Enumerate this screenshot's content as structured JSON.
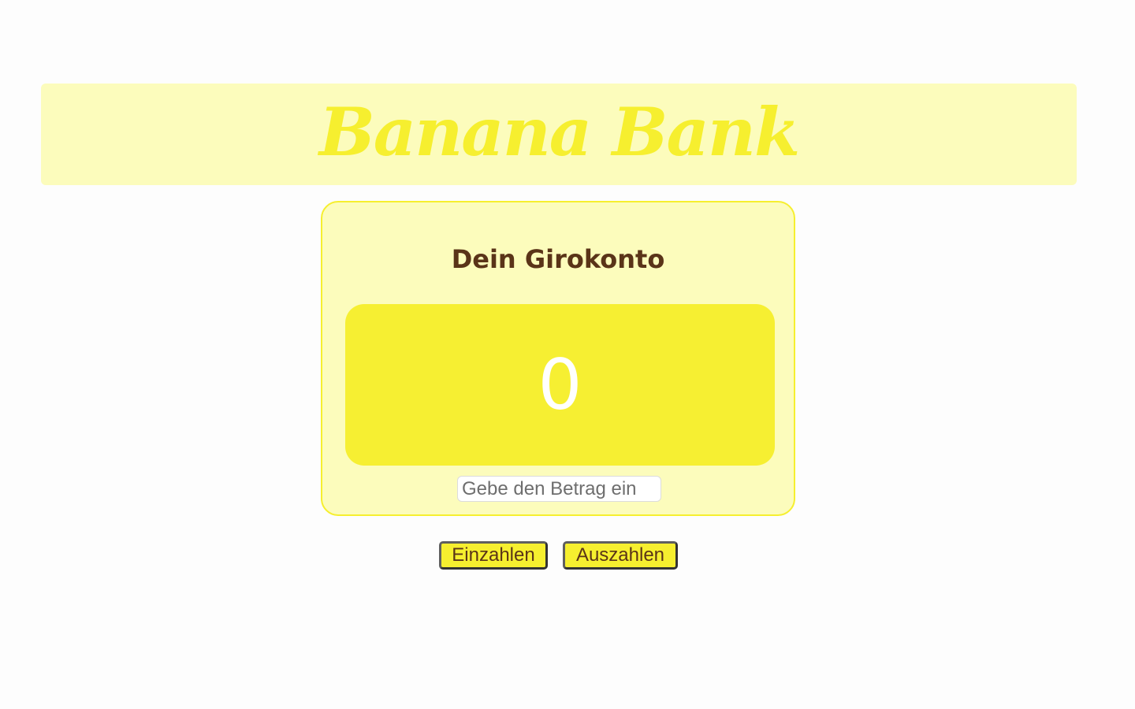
{
  "header": {
    "brand": "Banana Bank"
  },
  "account": {
    "title": "Dein Girokonto",
    "balance": "0",
    "amount_placeholder": "Gebe den Betrag ein"
  },
  "actions": {
    "deposit_label": "Einzahlen",
    "withdraw_label": "Auszahlen"
  },
  "colors": {
    "banana_yellow": "#f6ef2f",
    "pale_yellow": "#fcfcbc",
    "brown_text": "#5a3418"
  }
}
